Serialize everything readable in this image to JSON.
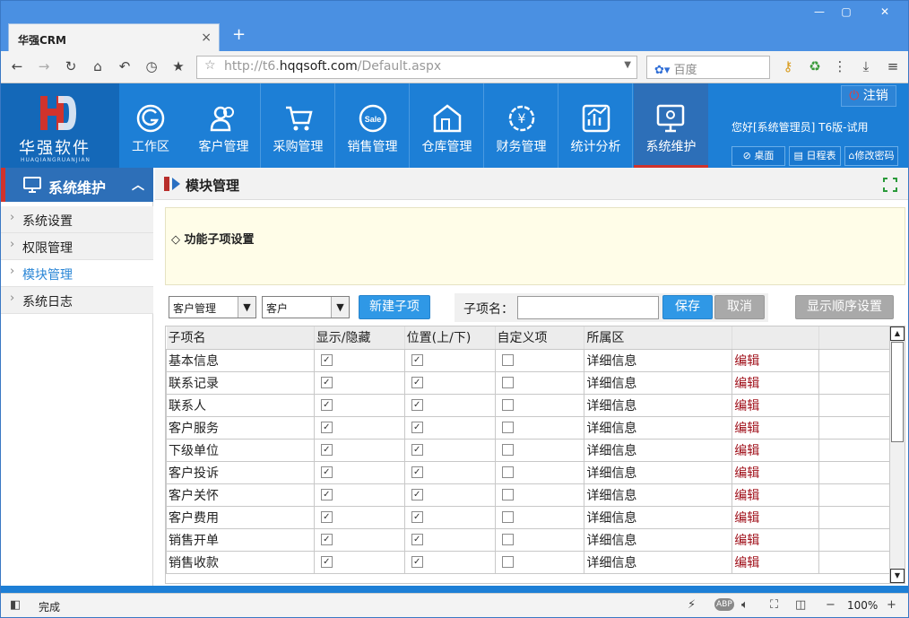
{
  "browser": {
    "tab_title": "华强CRM",
    "tab_close": "×",
    "new_tab": "+",
    "url_prefix": "http://t6.",
    "url_host": "hqqsoft.com",
    "url_path": "/Default.aspx",
    "search_placeholder": "百度",
    "status_text": "完成",
    "zoom": "100%"
  },
  "app": {
    "logo_text": "华强软件",
    "logo_pinyin": "HUAQIANGRUANJIAN",
    "logout_label": "注销",
    "welcome": "您好[系统管理员] T6版-试用",
    "shortcuts": [
      "桌面",
      "日程表",
      "修改密码"
    ],
    "modules": [
      {
        "label": "工作区",
        "icon": "workspace-icon"
      },
      {
        "label": "客户管理",
        "icon": "customers-icon"
      },
      {
        "label": "采购管理",
        "icon": "cart-icon"
      },
      {
        "label": "销售管理",
        "icon": "sale-icon"
      },
      {
        "label": "仓库管理",
        "icon": "warehouse-icon"
      },
      {
        "label": "财务管理",
        "icon": "yen-icon"
      },
      {
        "label": "统计分析",
        "icon": "chart-icon"
      },
      {
        "label": "系统维护",
        "icon": "system-icon",
        "active": true
      }
    ]
  },
  "sidebar": {
    "title": "系统维护",
    "items": [
      {
        "label": "系统设置"
      },
      {
        "label": "权限管理"
      },
      {
        "label": "模块管理",
        "active": true
      },
      {
        "label": "系统日志"
      }
    ]
  },
  "page": {
    "title": "模块管理",
    "section_title": "◇ 功能子项设置",
    "select1": "客户管理",
    "select2": "客户",
    "new_sub_button": "新建子项",
    "sub_name_label": "子项名：",
    "save_button": "保存",
    "cancel_button": "取消",
    "order_button": "显示顺序设置"
  },
  "table": {
    "headers": [
      "子项名",
      "显示/隐藏",
      "位置(上/下)",
      "自定义项",
      "所属区"
    ],
    "rows": [
      {
        "name": "基本信息",
        "show": true,
        "pos": true,
        "custom": false,
        "area": "详细信息",
        "action": "编辑"
      },
      {
        "name": "联系记录",
        "show": true,
        "pos": true,
        "custom": false,
        "area": "详细信息",
        "action": "编辑"
      },
      {
        "name": "联系人",
        "show": true,
        "pos": true,
        "custom": false,
        "area": "详细信息",
        "action": "编辑"
      },
      {
        "name": "客户服务",
        "show": true,
        "pos": true,
        "custom": false,
        "area": "详细信息",
        "action": "编辑"
      },
      {
        "name": "下级单位",
        "show": true,
        "pos": true,
        "custom": false,
        "area": "详细信息",
        "action": "编辑"
      },
      {
        "name": "客户投诉",
        "show": true,
        "pos": true,
        "custom": false,
        "area": "详细信息",
        "action": "编辑"
      },
      {
        "name": "客户关怀",
        "show": true,
        "pos": true,
        "custom": false,
        "area": "详细信息",
        "action": "编辑"
      },
      {
        "name": "客户费用",
        "show": true,
        "pos": true,
        "custom": false,
        "area": "详细信息",
        "action": "编辑"
      },
      {
        "name": "销售开单",
        "show": true,
        "pos": true,
        "custom": false,
        "area": "详细信息",
        "action": "编辑"
      },
      {
        "name": "销售收款",
        "show": true,
        "pos": true,
        "custom": false,
        "area": "详细信息",
        "action": "编辑"
      }
    ]
  },
  "colors": {
    "brand": "#1d7fd6",
    "accent_red": "#d0332c",
    "edit_link": "#a0111b"
  }
}
